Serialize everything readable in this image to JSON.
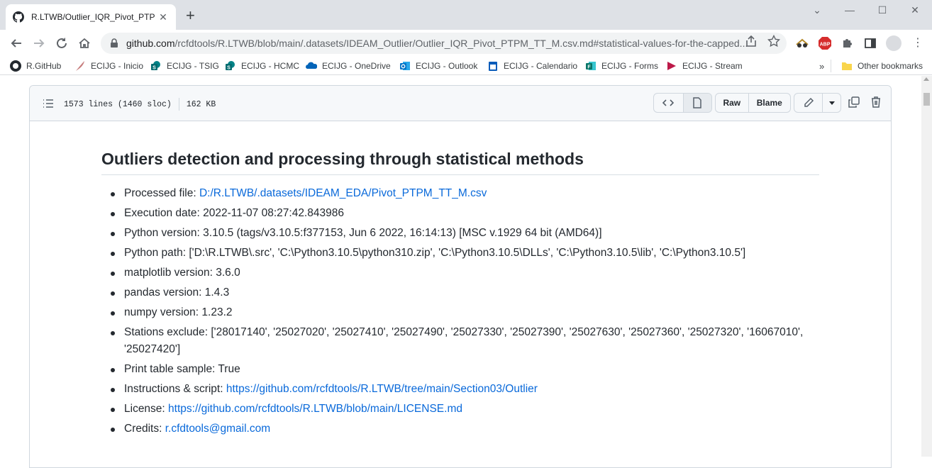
{
  "browser": {
    "tab_title": "R.LTWB/Outlier_IQR_Pivot_PTPM_TT_M.csv.md at main · rcfdtools/R.LTWB",
    "tab_title_visible": "R.LTWB/Outlier_IQR_Pivot_PTPM",
    "url_host": "github.com",
    "url_path": "/rcfdtools/R.LTWB/blob/main/.datasets/IDEAM_Outlier/Outlier_IQR_Pivot_PTPM_TT_M.csv.md#statistical-values-for-the-capped..."
  },
  "bookmarks": [
    {
      "label": "R.GitHub",
      "icon": "github-icon",
      "color": "#24292f"
    },
    {
      "label": "ECIJG - Inicio",
      "icon": "feather-icon",
      "color": "#c77d7d"
    },
    {
      "label": "ECIJG - TSIG",
      "icon": "sharepoint-icon",
      "color": "#038387"
    },
    {
      "label": "ECIJG - HCMC",
      "icon": "sharepoint-icon",
      "color": "#038387"
    },
    {
      "label": "ECIJG - OneDrive",
      "icon": "onedrive-icon",
      "color": "#0364b8"
    },
    {
      "label": "ECIJG - Outlook",
      "icon": "outlook-icon",
      "color": "#0072c6"
    },
    {
      "label": "ECIJG - Calendario",
      "icon": "calendar-icon",
      "color": "#0a5cba"
    },
    {
      "label": "ECIJG - Forms",
      "icon": "forms-icon",
      "color": "#077568"
    },
    {
      "label": "ECIJG - Stream",
      "icon": "stream-icon",
      "color": "#bc1948"
    }
  ],
  "other_bookmarks": "Other bookmarks",
  "file_header": {
    "lines": "1573 lines (1460 sloc)",
    "size": "162 KB",
    "raw": "Raw",
    "blame": "Blame"
  },
  "content": {
    "heading": "Outliers detection and processing through statistical methods",
    "items": [
      {
        "label": "Processed file: ",
        "value": "",
        "link": "D:/R.LTWB/.datasets/IDEAM_EDA/Pivot_PTPM_TT_M.csv"
      },
      {
        "label": "Execution date: 2022-11-07 08:27:42.843986",
        "value": "",
        "link": ""
      },
      {
        "label": "Python version: 3.10.5 (tags/v3.10.5:f377153, Jun 6 2022, 16:14:13) [MSC v.1929 64 bit (AMD64)]",
        "value": "",
        "link": ""
      },
      {
        "label": "Python path: ['D:\\R.LTWB\\.src', 'C:\\Python3.10.5\\python310.zip', 'C:\\Python3.10.5\\DLLs', 'C:\\Python3.10.5\\lib', 'C:\\Python3.10.5']",
        "value": "",
        "link": ""
      },
      {
        "label": "matplotlib version: 3.6.0",
        "value": "",
        "link": ""
      },
      {
        "label": "pandas version: 1.4.3",
        "value": "",
        "link": ""
      },
      {
        "label": "numpy version: 1.23.2",
        "value": "",
        "link": ""
      },
      {
        "label": "Stations exclude: ['28017140', '25027020', '25027410', '25027490', '25027330', '25027390', '25027630', '25027360', '25027320', '16067010', '25027420']",
        "value": "",
        "link": ""
      },
      {
        "label": "Print table sample: True",
        "value": "",
        "link": ""
      },
      {
        "label": "Instructions & script: ",
        "value": "",
        "link": "https://github.com/rcfdtools/R.LTWB/tree/main/Section03/Outlier"
      },
      {
        "label": "License: ",
        "value": "",
        "link": "https://github.com/rcfdtools/R.LTWB/blob/main/LICENSE.md"
      },
      {
        "label": "Credits: ",
        "value": "",
        "link": "r.cfdtools@gmail.com"
      }
    ]
  }
}
